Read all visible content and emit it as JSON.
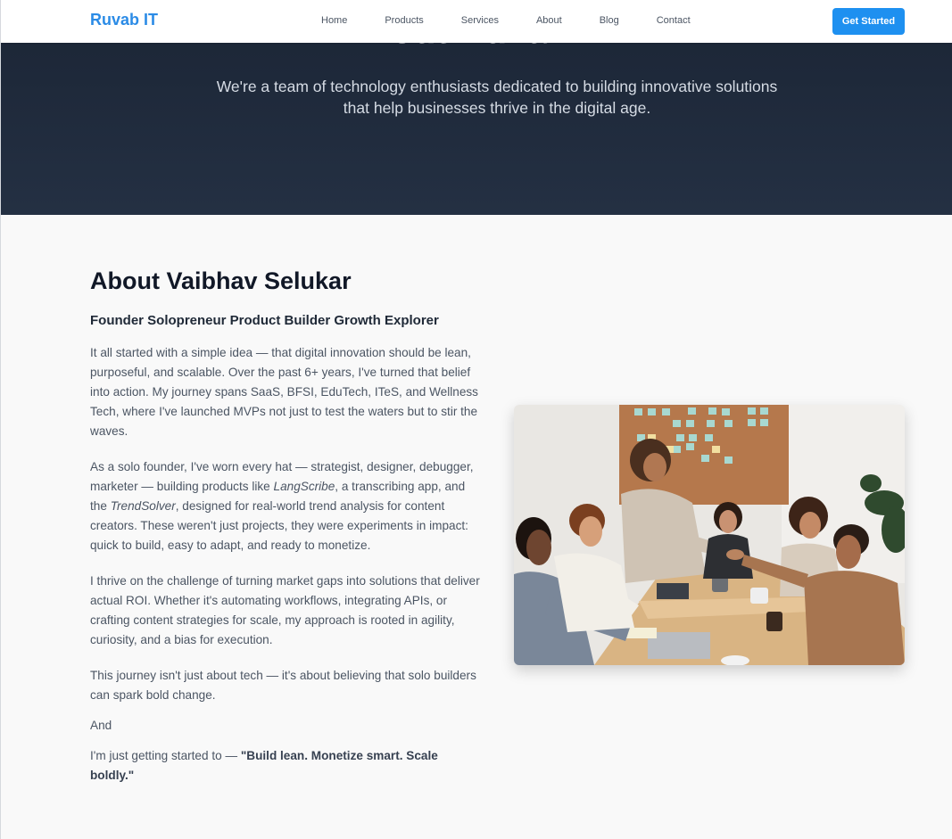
{
  "brand": {
    "name": "Ruvab IT",
    "color": "#2b8be6"
  },
  "nav": {
    "links": [
      "Home",
      "Products",
      "Services",
      "About",
      "Blog",
      "Contact"
    ],
    "cta": "Get Started"
  },
  "hero": {
    "title": "About Ruvab IT",
    "subtitle": "We're a team of technology enthusiasts dedicated to building innovative solutions that help businesses thrive in the digital age."
  },
  "about": {
    "title": "About Vaibhav Selukar",
    "subtitle": "Founder Solopreneur Product Builder Growth Explorer",
    "p1": "It all started with a simple idea — that digital innovation should be lean, purposeful, and scalable. Over the past 6+ years, I've turned that belief into action. My journey spans SaaS, BFSI, EduTech, ITeS, and Wellness Tech, where I've launched MVPs not just to test the waters but to stir the waves.",
    "p2": {
      "before": "As a solo founder, I've worn every hat — strategist, designer, debugger, marketer — building products like ",
      "product1": "LangScribe",
      "middle": ", a transcribing app, and the ",
      "product2": "TrendSolver",
      "after": ", designed for real-world trend analysis for content creators. These weren't just projects, they were experiments in impact: quick to build, easy to adapt, and ready to monetize."
    },
    "p3": "I thrive on the challenge of turning market gaps into solutions that deliver actual ROI. Whether it's automating workflows, integrating APIs, or crafting content strategies for scale, my approach is rooted in agility, curiosity, and a bias for execution.",
    "p4": "This journey isn't just about tech — it's about believing that solo builders can spark bold change.",
    "p5": "And",
    "p6": {
      "before": "I'm just getting started to — ",
      "quote": "\"Build lean. Monetize smart. Scale boldly.\""
    }
  },
  "colors": {
    "hero_bg": "#1b2535",
    "cta_bg": "#1e90f0",
    "page_bg": "#f9f9f9"
  }
}
